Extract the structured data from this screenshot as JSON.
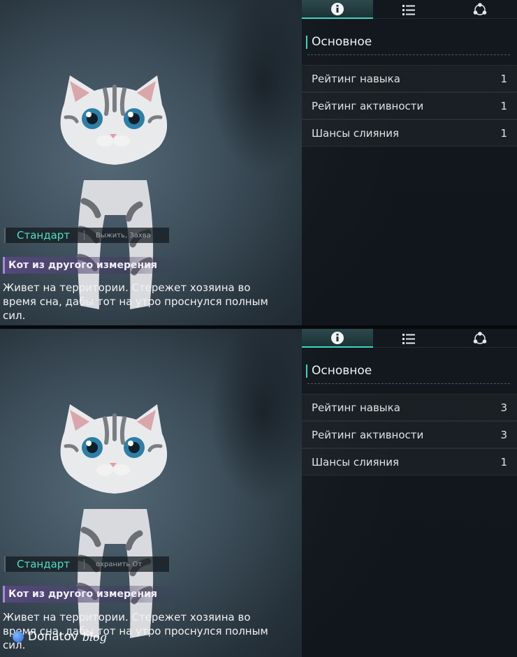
{
  "screens": [
    {
      "tabs": [
        {
          "icon": "info-icon",
          "active": true
        },
        {
          "icon": "list-icon",
          "active": false
        },
        {
          "icon": "share-icon",
          "active": false
        }
      ],
      "section_title": "Основное",
      "stats": [
        {
          "label": "Рейтинг навыка",
          "value": "1"
        },
        {
          "label": "Рейтинг активности",
          "value": "1"
        },
        {
          "label": "Шансы слияния",
          "value": "1"
        }
      ],
      "grade": "Стандарт",
      "skills_preview": "Выжить, Захва",
      "pet_name": "Кот из другого измерения",
      "description": "Живет на территории. Стережет хозяина во время сна, дабы тот на утро проснулся полным сил."
    },
    {
      "tabs": [
        {
          "icon": "info-icon",
          "active": true
        },
        {
          "icon": "list-icon",
          "active": false
        },
        {
          "icon": "share-icon",
          "active": false
        }
      ],
      "section_title": "Основное",
      "stats": [
        {
          "label": "Рейтинг навыка",
          "value": "3"
        },
        {
          "label": "Рейтинг активности",
          "value": "3"
        },
        {
          "label": "Шансы слияния",
          "value": "1"
        }
      ],
      "grade": "Стандарт",
      "skills_preview": "охранить  От",
      "pet_name": "Кот из другого измерения",
      "description": "Живет на территории. Стережет хозяина во время сна, дабы тот на утро проснулся полным сил."
    }
  ],
  "watermark": {
    "brand": "Donatov",
    "suffix": "blog"
  },
  "colors": {
    "accent": "#3fd6c0",
    "grade": "#4fe0c4",
    "name_bar": "#a48ad8"
  }
}
